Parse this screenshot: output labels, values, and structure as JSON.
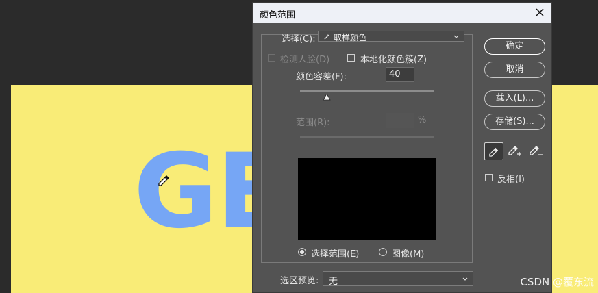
{
  "dialog": {
    "title": "颜色范围",
    "select_label": "选择(C):",
    "select_value": "取样颜色",
    "detect_faces": "检测人脸(D)",
    "localized_clusters": "本地化颜色簇(Z)",
    "fuzziness_label": "颜色容差(F):",
    "fuzziness_value": "40",
    "fuzziness_level": 0.2,
    "range_label": "范围(R):",
    "range_unit": "%",
    "radio_selection": "选择范围(E)",
    "radio_image": "图像(M)",
    "preview_label": "选区预览:",
    "preview_value": "无",
    "ok": "确定",
    "cancel": "取消",
    "load": "载入(L)...",
    "save": "存储(S)...",
    "invert": "反相(I)"
  },
  "canvas": {
    "big_text": "GE",
    "bg_color": "#f9ec77",
    "text_color": "#76a6f5"
  },
  "watermark": "CSDN @覆东流"
}
